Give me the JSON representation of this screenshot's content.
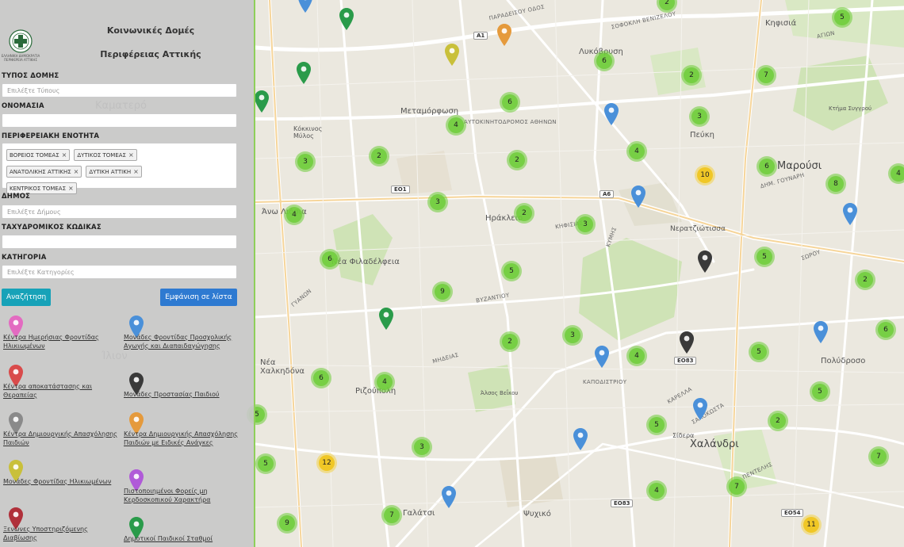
{
  "panel": {
    "title_line1": "Κοινωνικές Δομές",
    "title_line2": "Περιφέρειας Αττικής",
    "logo_caption": "ΕΛΛΗΝΙΚΗ ΔΗΜΟΚΡΑΤΙΑ ΠΕΡΙΦΕΡΕΙΑ ΑΤΤΙΚΗΣ",
    "fields": {
      "type": {
        "label": "ΤΥΠΟΣ ΔΟΜΗΣ",
        "placeholder": "Επιλέξτε Τύπους",
        "value": ""
      },
      "name": {
        "label": "ΟΝΟΜΑΣΙΑ",
        "placeholder": "",
        "value": ""
      },
      "region": {
        "label": "ΠΕΡΙΦΕΡΕΙΑΚΗ ΕΝΟΤΗΤΑ"
      },
      "municipality": {
        "label": "ΔΗΜΟΣ",
        "placeholder": "Επιλέξτε Δήμους",
        "value": ""
      },
      "postal": {
        "label": "ΤΑΧΥΔΡΟΜΙΚΟΣ ΚΩΔΙΚΑΣ",
        "placeholder": "",
        "value": ""
      },
      "category": {
        "label": "ΚΑΤΗΓΟΡΙΑ",
        "placeholder": "Επιλέξτε Κατηγορίες",
        "value": ""
      }
    },
    "region_tags": [
      "ΒΟΡΕΙΟΣ ΤΟΜΕΑΣ",
      "ΔΥΤΙΚΟΣ ΤΟΜΕΑΣ",
      "ΑΝΑΤΟΛΙΚΗΣ ΑΤΤΙΚΗΣ",
      "ΔΥΤΙΚΗ ΑΤΤΙΚΗ",
      "ΚΕΝΤΡΙΚΟΣ ΤΟΜΕΑΣ"
    ],
    "tag_remove_symbol": "×",
    "search_label": "Αναζήτηση",
    "list_label": "Εμφάνιση σε λίστα",
    "legend": [
      {
        "color": "#e36bc1",
        "label": "Κέντρα Ημερήσιας Φροντίδας Ηλικιωμένων"
      },
      {
        "color": "#4a90d9",
        "label": "Μονάδες Φροντίδας Προσχολικής Αγωγής και Διαπαιδαγώγησης"
      },
      {
        "color": "#d94b4b",
        "label": "Κέντρα αποκατάστασης και Θεραπείας"
      },
      {
        "color": "#3a3a3a",
        "label": "Μονάδες Προστασίας Παιδιού"
      },
      {
        "color": "#8a8a8a",
        "label": "Κέντρα Δημιουργικής Απασχόλησης Παιδιών"
      },
      {
        "color": "#e59a3c",
        "label": "Κέντρα Δημιουργικής Απασχόλησης Παιδιών με Ειδικές Ανάγκες"
      },
      {
        "color": "#c9c03a",
        "label": "Μονάδες Φροντίδας Ηλικιωμένων"
      },
      {
        "color": "#b05ad8",
        "label": "Πιστοποιημένοι Φορείς μη Κερδοσκοπικού Χαρακτήρα"
      },
      {
        "color": "#b0303a",
        "label": "Ξενώνες Υποστηριζόμενης Διαβίωσης"
      },
      {
        "color": "#2a9b4a",
        "label": "Δημοτικοί Παιδικοί Σταθμοί"
      }
    ]
  },
  "map": {
    "places": [
      {
        "text": "Κηφισιά"
      },
      {
        "text": "Λυκόβρυση"
      },
      {
        "text": "Πεύκη"
      },
      {
        "text": "Μεταμόρφωση"
      },
      {
        "text": "Κόκκινος Μύλος"
      },
      {
        "text": "Καματερό"
      },
      {
        "text": "Ηράκλειο"
      },
      {
        "text": "Νέα Φιλαδέλφεια"
      },
      {
        "text": "Νερατζιώτισσα"
      },
      {
        "text": "Νέα Χαλκηδόνα"
      },
      {
        "text": "Ριζούπολη"
      },
      {
        "text": "Άλσος Βεΐκου"
      },
      {
        "text": "Σίδερα"
      },
      {
        "text": "Χαλάνδρι"
      },
      {
        "text": "Πολύδροσο"
      },
      {
        "text": "Μαρούσι"
      },
      {
        "text": "Κτήμα Συγγρού"
      },
      {
        "text": "Ψυχικό"
      },
      {
        "text": "Γαλάτσι"
      },
      {
        "text": "Ίλιον"
      },
      {
        "text": "Άνω Λιόσια"
      }
    ],
    "roads": [
      {
        "text": "ΠΑΡΑΔΕΙΣΟΥ ΟΔΟΣ"
      },
      {
        "text": "ΣΟΦΟΚΛΗ ΒΕΝΙΖΕΛΟΥ"
      },
      {
        "text": "ΑΥΤΟΚΙΝΗΤΟΔΡΟΜΟΣ ΑΘΗΝΩΝ"
      },
      {
        "text": "ΚΗΦΙΣΙΑΣ"
      },
      {
        "text": "ΚΥΜΗΣ"
      },
      {
        "text": "ΒΥΖΑΝΤΙΟΥ"
      },
      {
        "text": "ΜΗΔΕΙΑΣ"
      },
      {
        "text": "ΓΥΑΝΩΝ"
      },
      {
        "text": "ΚΑΠΟΔΙΣΤΡΙΟΥ"
      },
      {
        "text": "ΚΑΡΕΛΛΑ"
      },
      {
        "text": "ΣΑΛΟΚΩΣΤΑ"
      },
      {
        "text": "ΠΕΝΤΕΛΗΣ"
      },
      {
        "text": "ΣΩΡΟΥ"
      },
      {
        "text": "ΔΗΜ. ΓΟΥΝΑΡΗ"
      },
      {
        "text": "ΑΓΙΩΝ"
      }
    ],
    "shields": [
      {
        "text": "A1"
      },
      {
        "text": "EO1"
      },
      {
        "text": "A6"
      },
      {
        "text": "EO83"
      },
      {
        "text": "EO83"
      },
      {
        "text": "EO54"
      }
    ],
    "clusters": [
      {
        "count": "2",
        "color": "green"
      },
      {
        "count": "5",
        "color": "green"
      },
      {
        "count": "6",
        "color": "green"
      },
      {
        "count": "2",
        "color": "green"
      },
      {
        "count": "7",
        "color": "green"
      },
      {
        "count": "6",
        "color": "green"
      },
      {
        "count": "4",
        "color": "green"
      },
      {
        "count": "3",
        "color": "green"
      },
      {
        "count": "4",
        "color": "green"
      },
      {
        "count": "2",
        "color": "green"
      },
      {
        "count": "2",
        "color": "green"
      },
      {
        "count": "10",
        "color": "yellow"
      },
      {
        "count": "6",
        "color": "green"
      },
      {
        "count": "8",
        "color": "green"
      },
      {
        "count": "4",
        "color": "green"
      },
      {
        "count": "3",
        "color": "green"
      },
      {
        "count": "3",
        "color": "green"
      },
      {
        "count": "4",
        "color": "green"
      },
      {
        "count": "2",
        "color": "green"
      },
      {
        "count": "3",
        "color": "green"
      },
      {
        "count": "6",
        "color": "green"
      },
      {
        "count": "5",
        "color": "green"
      },
      {
        "count": "5",
        "color": "green"
      },
      {
        "count": "9",
        "color": "green"
      },
      {
        "count": "2",
        "color": "green"
      },
      {
        "count": "2",
        "color": "green"
      },
      {
        "count": "6",
        "color": "green"
      },
      {
        "count": "3",
        "color": "green"
      },
      {
        "count": "4",
        "color": "green"
      },
      {
        "count": "5",
        "color": "green"
      },
      {
        "count": "6",
        "color": "green"
      },
      {
        "count": "4",
        "color": "green"
      },
      {
        "count": "5",
        "color": "green"
      },
      {
        "count": "2",
        "color": "green"
      },
      {
        "count": "5",
        "color": "green"
      },
      {
        "count": "3",
        "color": "green"
      },
      {
        "count": "12",
        "color": "yellow"
      },
      {
        "count": "5",
        "color": "green"
      },
      {
        "count": "7",
        "color": "green"
      },
      {
        "count": "7",
        "color": "green"
      },
      {
        "count": "4",
        "color": "green"
      },
      {
        "count": "9",
        "color": "green"
      },
      {
        "count": "7",
        "color": "green"
      },
      {
        "count": "11",
        "color": "yellow"
      },
      {
        "count": "5",
        "color": "green"
      }
    ],
    "pins": [
      {
        "color": "#2a9b4a"
      },
      {
        "color": "#2a9b4a"
      },
      {
        "color": "#2a9b4a"
      },
      {
        "color": "#c9c03a"
      },
      {
        "color": "#e59a3c"
      },
      {
        "color": "#4a90d9"
      },
      {
        "color": "#4a90d9"
      },
      {
        "color": "#4a90d9"
      },
      {
        "color": "#3a3a3a"
      },
      {
        "color": "#3a3a3a"
      },
      {
        "color": "#4a90d9"
      },
      {
        "color": "#2a9b4a"
      },
      {
        "color": "#4a90d9"
      },
      {
        "color": "#4a90d9"
      },
      {
        "color": "#4a90d9"
      },
      {
        "color": "#4a90d9"
      },
      {
        "color": "#4a90d9"
      }
    ]
  }
}
